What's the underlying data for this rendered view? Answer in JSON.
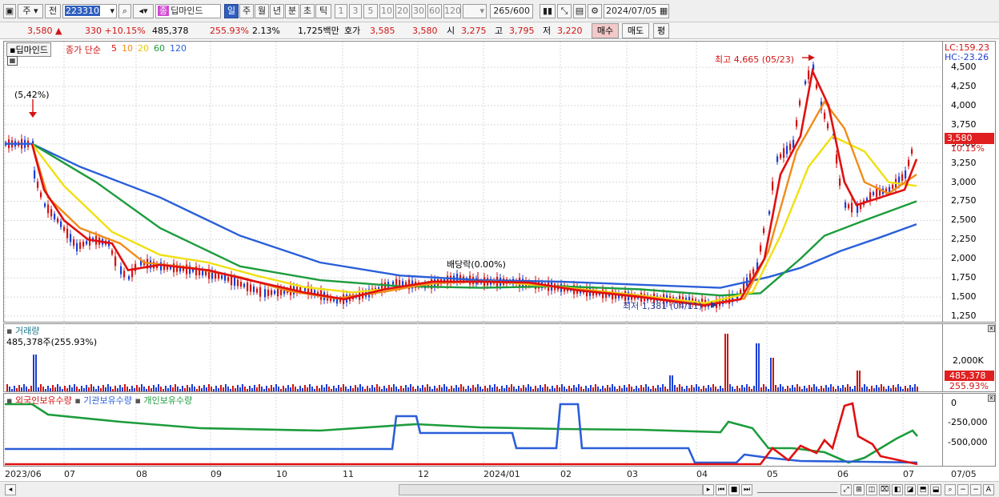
{
  "toolbar": {
    "market": "주",
    "scope": "전",
    "code": "223310",
    "stock_name": "딥마인드",
    "stock_tag": "종",
    "periods": [
      "일",
      "주",
      "월",
      "년",
      "분",
      "초",
      "틱"
    ],
    "active_period": "일",
    "intervals": [
      "1",
      "3",
      "5",
      "10",
      "20",
      "30",
      "60",
      "120"
    ],
    "count": "265",
    "count_total": "/600",
    "date": "2024/07/05"
  },
  "quote": {
    "price": "3,580",
    "change": "330",
    "change_pct": "+10.15%",
    "volume": "485,378",
    "volume_ratio": "255.93%",
    "turnover": "2.13%",
    "amount": "1,725백만",
    "ask_label": "호가",
    "ask1": "3,585",
    "ask2": "3,580",
    "open_label": "시",
    "open": "3,275",
    "high_label": "고",
    "high": "3,795",
    "low_label": "저",
    "low": "3,220",
    "buy": "매수",
    "sell": "매도",
    "eval": "평"
  },
  "price_panel": {
    "name": "딥마인드",
    "ma_label": "종가 단순",
    "ma_periods": [
      "5",
      "10",
      "20",
      "60",
      "120"
    ],
    "ma_colors": [
      "#e01010",
      "#f08c18",
      "#f0e010",
      "#1c9c3c",
      "#2a5fd8"
    ],
    "lc": "LC:159.23",
    "hc": "HC:-23.26",
    "y_ticks": [
      "4,500",
      "4,250",
      "4,000",
      "3,750",
      "3,500",
      "3,250",
      "3,000",
      "2,750",
      "2,500",
      "2,250",
      "2,000",
      "1,750",
      "1,500",
      "1,250"
    ],
    "cur_price_box": "3,580",
    "cur_pct": "10.15%",
    "high_note": "최고 4,665 (05/23)",
    "low_note": "최저 1,381 (04/11)",
    "split_note": "(5,42%)",
    "dividend_note": "배당락(0.00%)"
  },
  "volume_panel": {
    "title": "거래량",
    "value": "485,378주(255.93%)",
    "y_tick": "2,000K",
    "cur_box": "485,378",
    "cur_pct": "255.93%"
  },
  "holding_panel": {
    "foreign": "외국인보유수량",
    "inst": "기관보유수량",
    "indiv": "개인보유수량",
    "y_ticks": [
      "0",
      "-250,000",
      "-500,000"
    ]
  },
  "x_axis": [
    "2023/06",
    "07",
    "08",
    "09",
    "10",
    "11",
    "12",
    "2024/01",
    "02",
    "03",
    "04",
    "05",
    "06",
    "07"
  ],
  "x_end": "07/05"
}
